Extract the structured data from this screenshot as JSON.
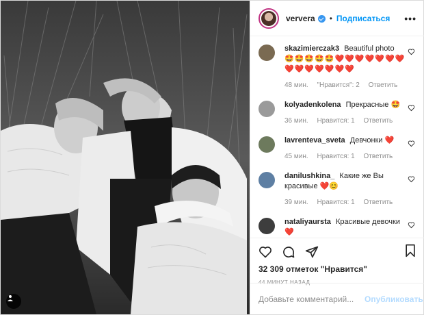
{
  "header": {
    "username": "ververa",
    "separator": "•",
    "follow_label": "Подписаться",
    "more_label": "•••"
  },
  "comments": [
    {
      "user": "skazimierczak3",
      "text": "Beautiful photo",
      "text2": "🤩🤩🤩🤩🤩❤️❤️❤️❤️❤️❤️❤️❤️❤️❤️❤️❤️❤️❤️",
      "time": "48 мин.",
      "likes": "\"Нравится\": 2",
      "reply": "Ответить"
    },
    {
      "user": "kolyadenkolena",
      "text": "Прекрасные 🤩",
      "time": "36 мин.",
      "likes": "Нравится: 1",
      "reply": "Ответить"
    },
    {
      "user": "lavrenteva_sveta",
      "text": "Девчонки ❤️",
      "time": "45 мин.",
      "likes": "Нравится: 1",
      "reply": "Ответить"
    },
    {
      "user": "danilushkina_",
      "text": "Какие же Вы красивые ❤️😊",
      "time": "39 мин.",
      "likes": "Нравится: 1",
      "reply": "Ответить"
    },
    {
      "user": "nataliyaursta",
      "text": "Красивые девочки ❤️",
      "time": "",
      "likes": "",
      "reply": ""
    }
  ],
  "likes": {
    "count": "32 309",
    "label": "отметок \"Нравится\""
  },
  "timestamp": "44 МИНУТ НАЗАД",
  "add_comment": {
    "placeholder": "Добавьте комментарий...",
    "publish_label": "Опубликовать"
  },
  "colors": {
    "accent": "#0095f6",
    "heart": "#e0245e",
    "muted": "#8e8e8e"
  },
  "icons": [
    "tag-icon",
    "verified-icon",
    "heart-icon",
    "comment-icon",
    "share-icon",
    "bookmark-icon",
    "more-icon"
  ]
}
